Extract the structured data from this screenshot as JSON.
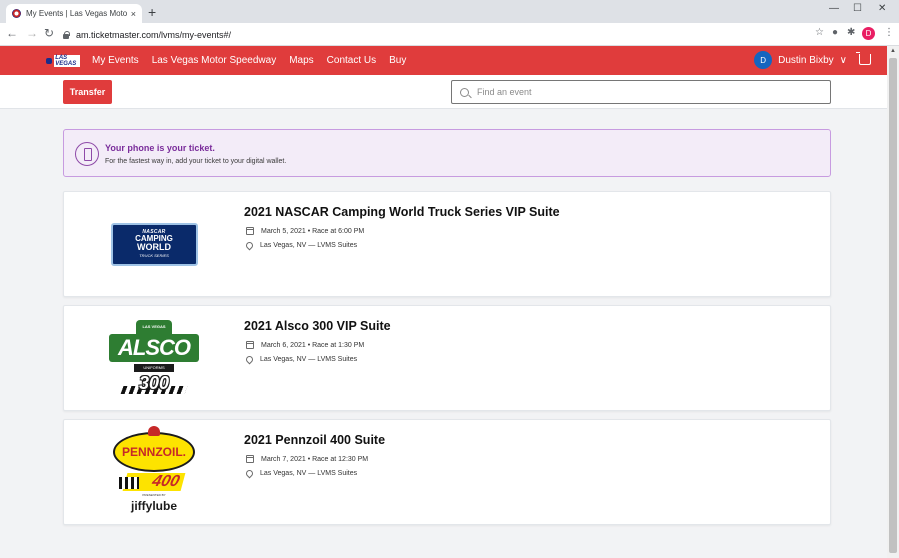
{
  "browser": {
    "tab_title": "My Events | Las Vegas Motor Spe",
    "tab_close": "×",
    "new_tab": "+",
    "url": "am.ticketmaster.com/lvms/my-events#/",
    "window_controls": [
      "—",
      "☐",
      "✕"
    ],
    "profile_initial": "D"
  },
  "site": {
    "logo_text": "LAS VEGAS",
    "nav": [
      "My Events",
      "Las Vegas Motor Speedway",
      "Maps",
      "Contact Us",
      "Buy"
    ],
    "user_initial": "D",
    "user_name": "Dustin Bixby",
    "user_caret": "∨"
  },
  "toolbar": {
    "transfer_label": "Transfer",
    "search_placeholder": "Find an event"
  },
  "notice": {
    "title": "Your phone is your ticket.",
    "message": "For the fastest way in, add your ticket to your digital wallet."
  },
  "events": [
    {
      "title": "2021 NASCAR Camping World Truck Series VIP Suite",
      "date": "March 5, 2021 • Race at 6:00 PM",
      "location": "Las Vegas, NV — LVMS Suites",
      "logo": {
        "l1": "NASCAR",
        "l2": "CAMPING",
        "l3": "WORLD",
        "l4": "TRUCK SERIES"
      }
    },
    {
      "title": "2021 Alsco 300 VIP Suite",
      "date": "March 6, 2021 • Race at 1:30 PM",
      "location": "Las Vegas, NV — LVMS Suites",
      "logo": {
        "top": "LAS VEGAS",
        "word": "ALSCO",
        "sub": "UNIFORMS",
        "num": "300"
      }
    },
    {
      "title": "2021 Pennzoil 400 Suite",
      "date": "March 7, 2021 • Race at 12:30 PM",
      "location": "Las Vegas, NV — LVMS Suites",
      "logo": {
        "word": "PENNZOIL.",
        "num": "400",
        "pres": "PRESENTED BY",
        "sponsor": "jiffylube"
      }
    }
  ],
  "colors": {
    "brand_red": "#e03c3c",
    "notice_bg": "#f3ecf8",
    "notice_accent": "#7a2d9b",
    "avatar_blue": "#1565c0"
  }
}
